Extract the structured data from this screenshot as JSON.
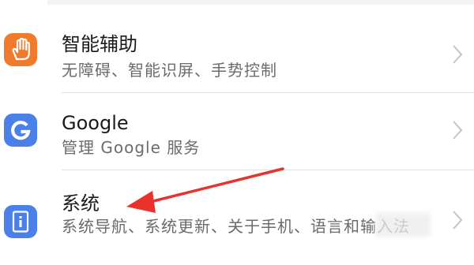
{
  "settings": {
    "items": [
      {
        "title": "智能辅助",
        "subtitle": "无障碍、智能识屏、手势控制",
        "icon": "hand-icon",
        "icon_color": "#f07b2d"
      },
      {
        "title": "Google",
        "subtitle": "管理 Google 服务",
        "icon": "google-g-icon",
        "icon_color": "#4a80e8"
      },
      {
        "title": "系统",
        "subtitle": "系统导航、系统更新、关于手机、语言和输入法",
        "icon": "system-phone-icon",
        "icon_color": "#4a80e8"
      }
    ]
  },
  "annotation": {
    "arrow_color": "#e8322b"
  }
}
